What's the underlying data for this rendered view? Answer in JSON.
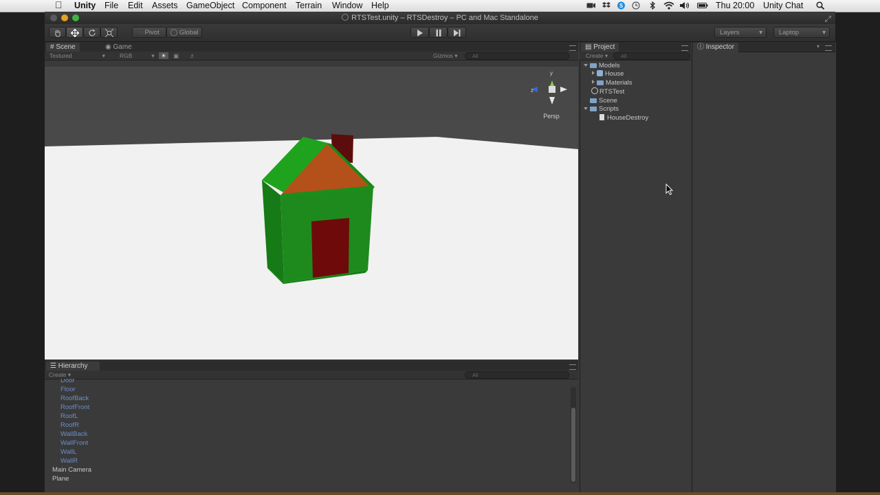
{
  "menubar": {
    "app": "Unity",
    "items": [
      "File",
      "Edit",
      "Assets",
      "GameObject",
      "Component",
      "Terrain",
      "Window",
      "Help"
    ],
    "clock": "Thu 20:00",
    "user": "Unity Chat"
  },
  "window": {
    "title": "RTSTest.unity – RTSDestroy – PC and Mac Standalone"
  },
  "toolbar": {
    "pivot": "Pivot",
    "global": "Global",
    "layers": "Layers",
    "layout": "Laptop"
  },
  "scene_panel": {
    "tabs": [
      "Scene",
      "Game"
    ],
    "render_mode": "Textured",
    "color_mode": "RGB",
    "gizmos": "Gizmos",
    "search_placeholder": "All",
    "persp_label": "Persp",
    "axis_y": "y",
    "axis_z": "z"
  },
  "project_panel": {
    "tab": "Project",
    "create": "Create",
    "search_placeholder": "All",
    "items": [
      {
        "label": "Models",
        "kind": "folder",
        "open": true,
        "indent": 0
      },
      {
        "label": "House",
        "kind": "model",
        "open": false,
        "indent": 1
      },
      {
        "label": "Materials",
        "kind": "folder",
        "open": false,
        "indent": 1
      },
      {
        "label": "RTSTest",
        "kind": "scene",
        "open": null,
        "indent": 0
      },
      {
        "label": "Scene",
        "kind": "folder",
        "open": null,
        "indent": 0
      },
      {
        "label": "Scripts",
        "kind": "folder",
        "open": true,
        "indent": 0
      },
      {
        "label": "HouseDestroy",
        "kind": "script",
        "open": null,
        "indent": 1
      }
    ]
  },
  "inspector_panel": {
    "tab": "Inspector"
  },
  "hierarchy_panel": {
    "tab": "Hierarchy",
    "create": "Create",
    "search_placeholder": "All",
    "partial_item": "Door",
    "children": [
      "Floor",
      "RoofBack",
      "RoofFront",
      "RoofL",
      "RoofR",
      "WallBack",
      "WallFront",
      "WallL",
      "WallR"
    ],
    "roots": [
      "Main Camera",
      "Plane"
    ]
  },
  "colors": {
    "child_text": "#6c8fc9",
    "panel_bg": "#3a3a3a",
    "house_green": "#1f8a1f",
    "roof_orange": "#b34a12",
    "door_red": "#6e0a0a"
  }
}
